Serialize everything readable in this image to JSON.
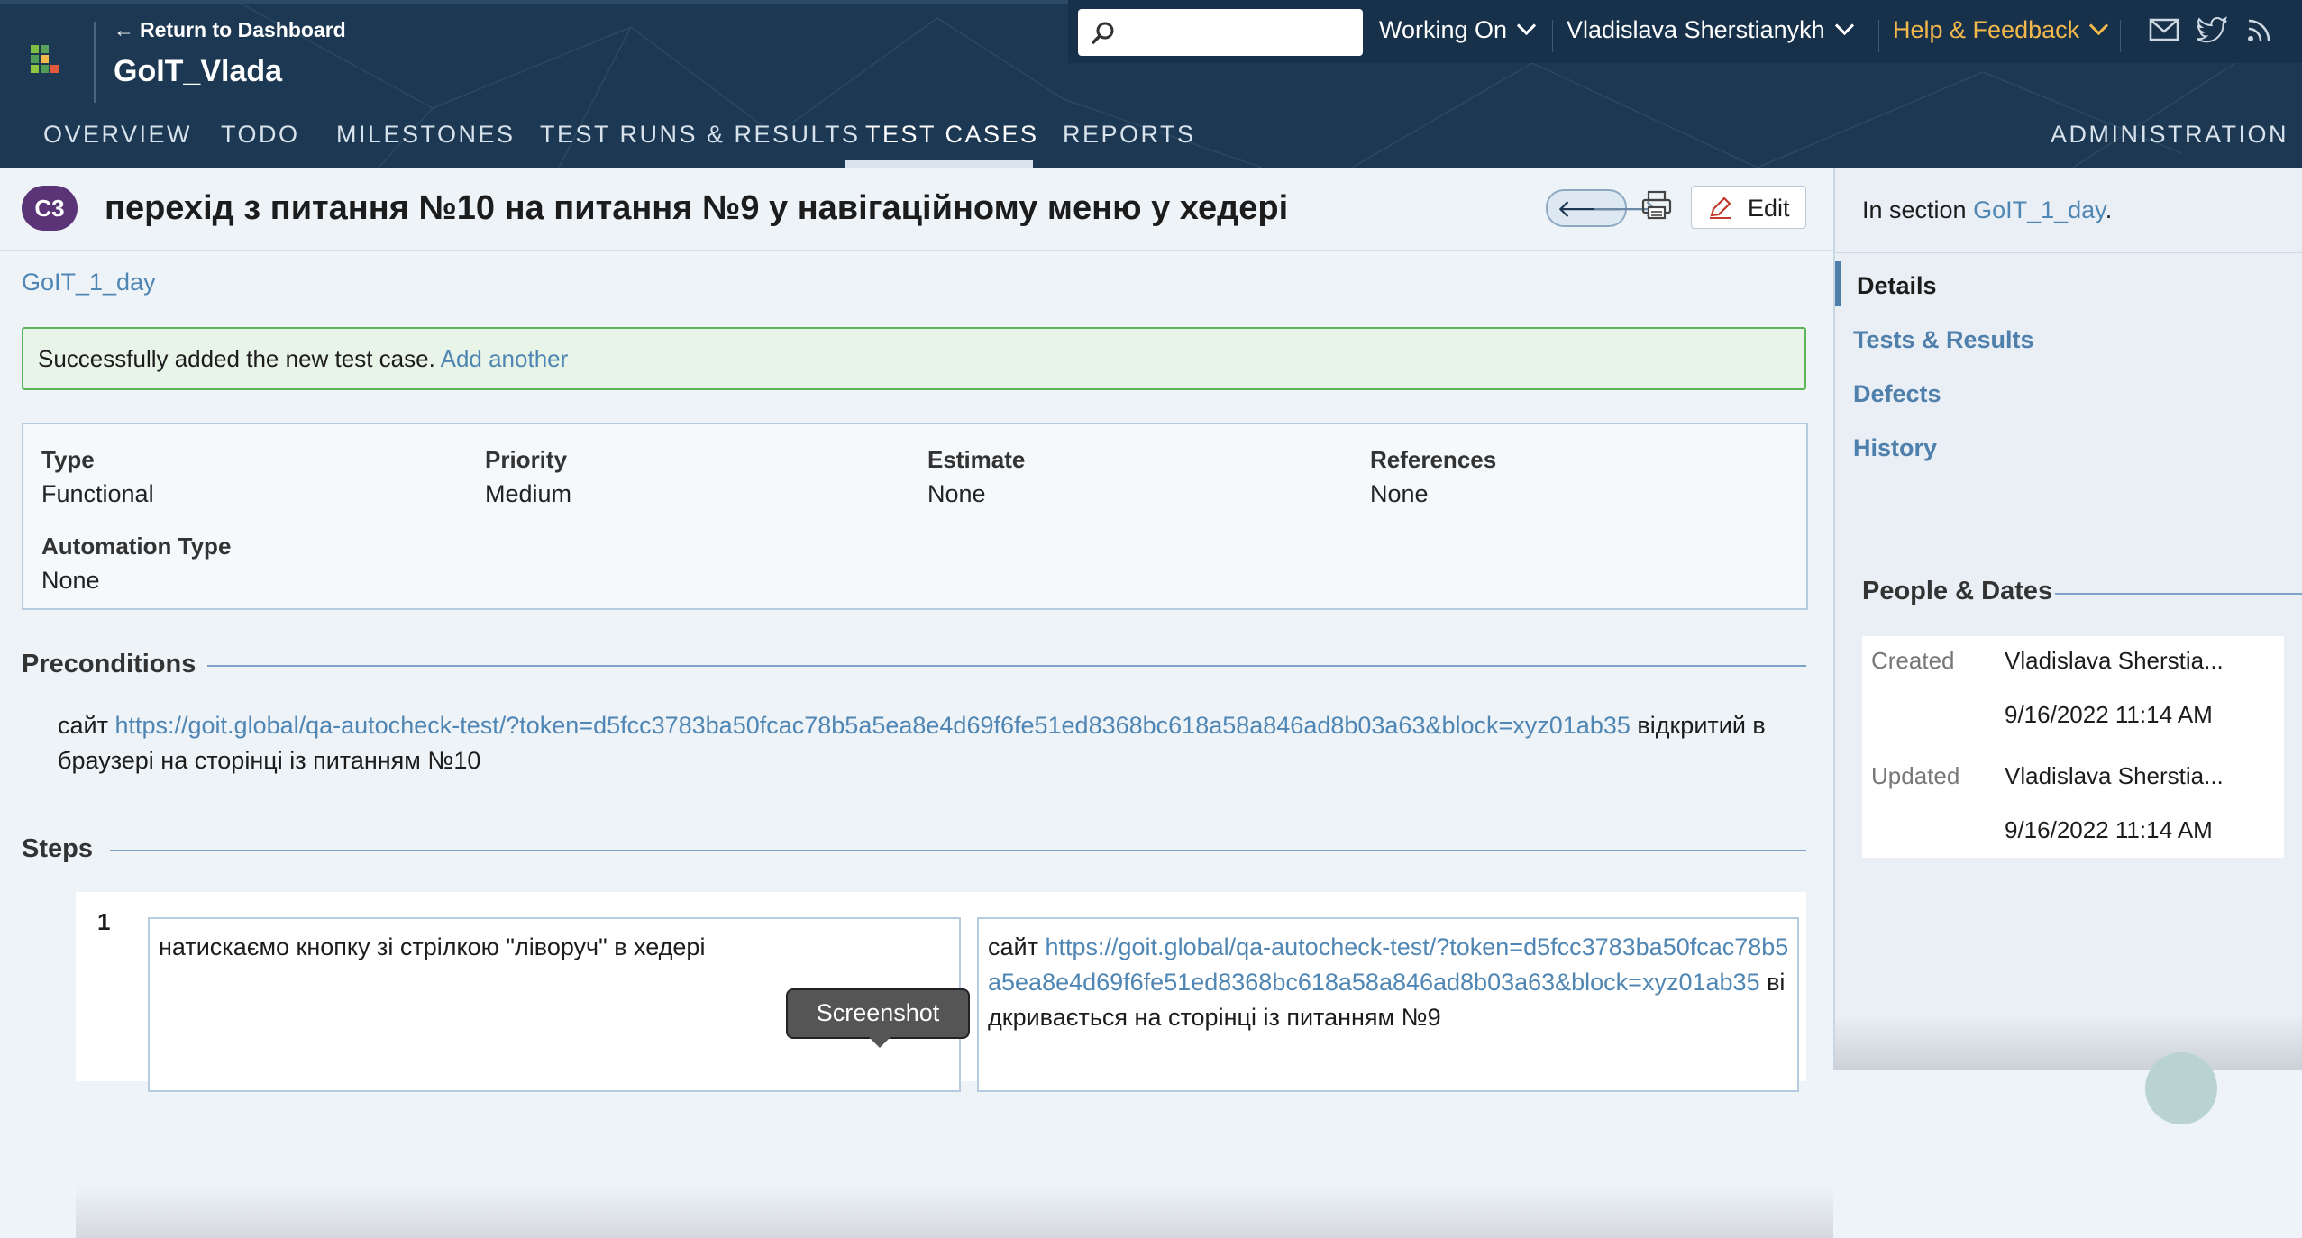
{
  "header": {
    "return_label": "Return to Dashboard",
    "project_name": "GoIT_Vlada",
    "search": {
      "placeholder": ""
    },
    "working_on": "Working On",
    "user_name": "Vladislava Sherstianykh",
    "help": "Help & Feedback",
    "help_color": "#f2b84b",
    "icons": [
      "logo-icon",
      "search-icon",
      "mail-icon",
      "twitter-icon",
      "rss-icon"
    ]
  },
  "nav": {
    "tabs": [
      "OVERVIEW",
      "TODO",
      "MILESTONES",
      "TEST RUNS & RESULTS",
      "TEST CASES",
      "REPORTS"
    ],
    "active": "TEST CASES",
    "admin": "ADMINISTRATION"
  },
  "case": {
    "badge": "C3",
    "title": "перехід з питання №10 на питання №9 у навігаційному меню у хедері",
    "edit_label": "Edit",
    "breadcrumb": "GoIT_1_day"
  },
  "alert": {
    "text": "Successfully added the new test case.",
    "link": "Add another"
  },
  "fields": {
    "type_label": "Type",
    "type_value": "Functional",
    "priority_label": "Priority",
    "priority_value": "Medium",
    "estimate_label": "Estimate",
    "estimate_value": "None",
    "references_label": "References",
    "references_value": "None",
    "automation_label": "Automation Type",
    "automation_value": "None"
  },
  "preconditions": {
    "heading": "Preconditions",
    "prefix": "сайт",
    "url": "https://goit.global/qa-autocheck-test/?token=d5fcc3783ba50fcac78b5a5ea8e4d69f6fe51ed8368bc618a58a846ad8b03a63&block=xyz01ab35",
    "suffix": "відкритий в браузері на сторінці із питанням №10"
  },
  "steps": {
    "heading": "Steps",
    "number": "1",
    "action": "натискаємо кнопку зі стрілкою \"ліворуч\" в хедері",
    "expected_prefix": "сайт",
    "expected_url": "https://goit.global/qa-autocheck-test/?token=d5fcc3783ba50fcac78b5a5ea8e4d69f6fe51ed8368bc618a58a846ad8b03a63&block=xyz01ab35",
    "expected_suffix": "відкривається на сторінці із питанням №9",
    "tooltip": "Screenshot"
  },
  "sidebar": {
    "in_section_prefix": "In section",
    "in_section_link": "GoIT_1_day",
    "in_section_suffix": ".",
    "items": [
      "Details",
      "Tests & Results",
      "Defects",
      "History"
    ],
    "active": "Details"
  },
  "people": {
    "heading": "People & Dates",
    "created_label": "Created",
    "created_by": "Vladislava Sherstia...",
    "created_date": "9/16/2022 11:14 AM",
    "updated_label": "Updated",
    "updated_by": "Vladislava Sherstia...",
    "updated_date": "9/16/2022 11:14 AM"
  }
}
